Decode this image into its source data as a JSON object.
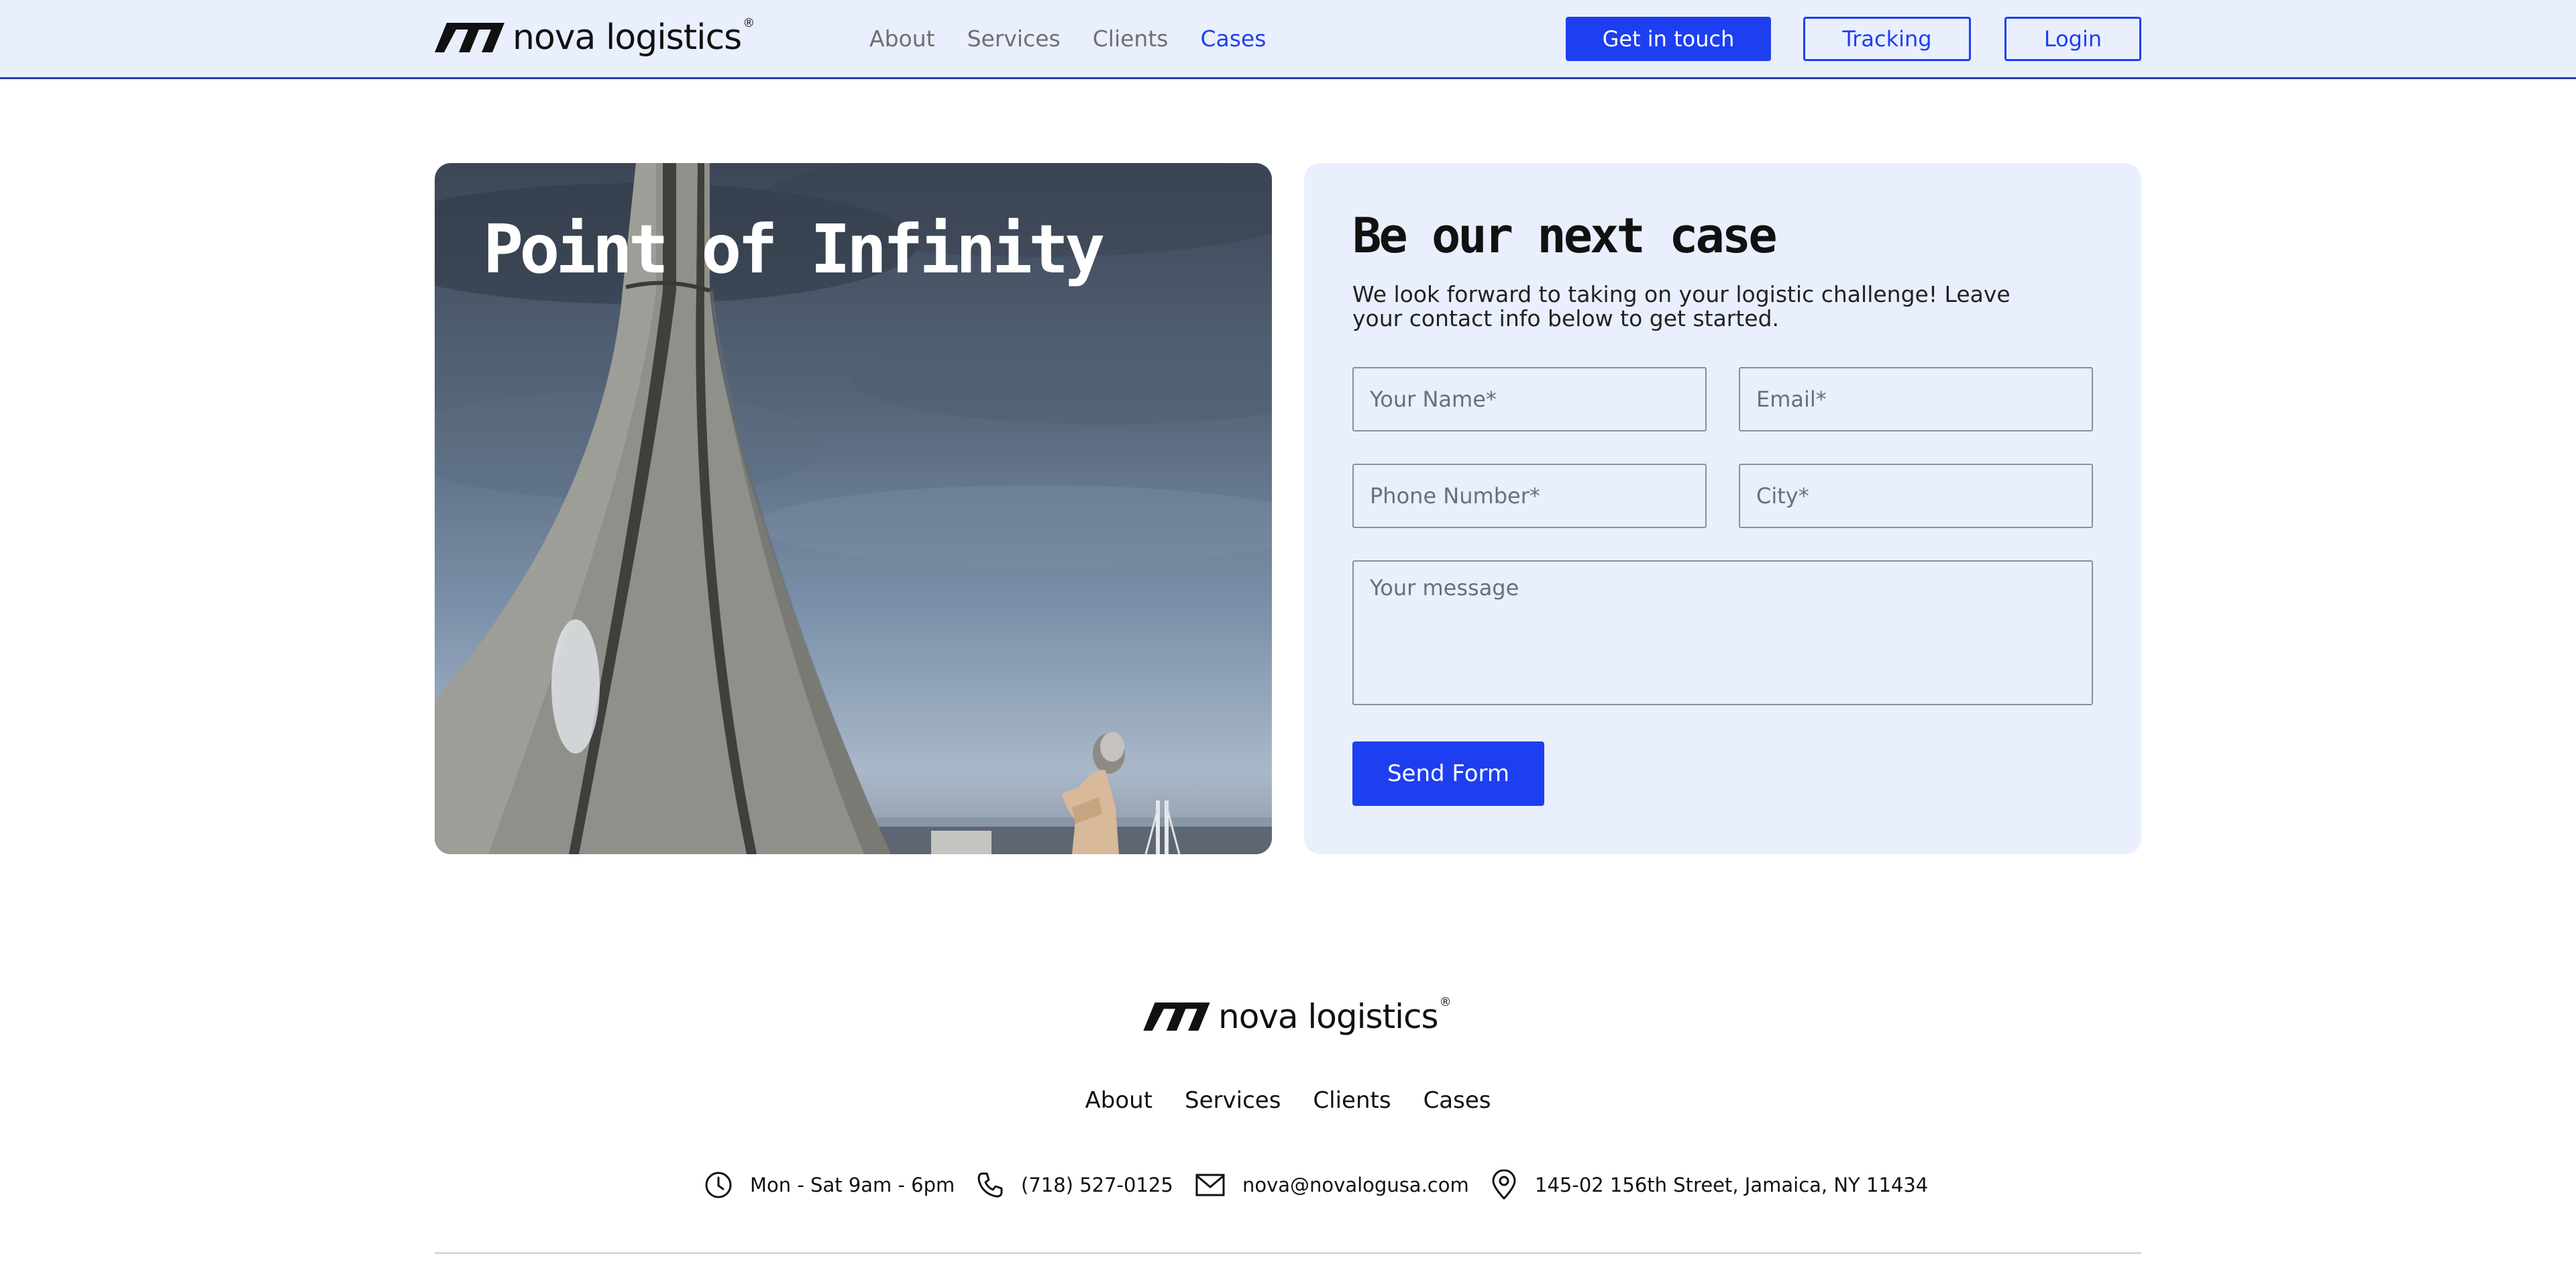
{
  "header": {
    "brand": "nova logistics",
    "brand_mark": "®",
    "nav": [
      "About",
      "Services",
      "Clients",
      "Cases"
    ],
    "active_nav": "Cases",
    "cta_label": "Get in touch",
    "tracking_label": "Tracking",
    "login_label": "Login"
  },
  "hero": {
    "title": "Point of Infinity"
  },
  "form": {
    "title": "Be our next case",
    "subtitle": "We look forward to taking on your logistic challenge! Leave your contact info below to get started.",
    "name_placeholder": "Your Name*",
    "email_placeholder": "Email*",
    "phone_placeholder": "Phone Number*",
    "city_placeholder": "City*",
    "message_placeholder": "Your message",
    "submit_label": "Send Form"
  },
  "footer": {
    "brand": "nova logistics",
    "brand_mark": "®",
    "nav": [
      "About",
      "Services",
      "Clients",
      "Cases"
    ],
    "contacts": [
      {
        "icon": "clock-icon",
        "text": "Mon - Sat 9am - 6pm"
      },
      {
        "icon": "phone-icon",
        "text": "(718) 527-0125"
      },
      {
        "icon": "mail-icon",
        "text": "nova@novalogusa.com"
      },
      {
        "icon": "location-pin-icon",
        "text": "145-02 156th Street, Jamaica, NY 11434"
      }
    ]
  },
  "colors": {
    "accent": "#1e3ff0",
    "header_bg": "#e9effd",
    "card_bg": "#e9effd",
    "text": "#111111",
    "nav_inactive": "#6f6f6f"
  }
}
